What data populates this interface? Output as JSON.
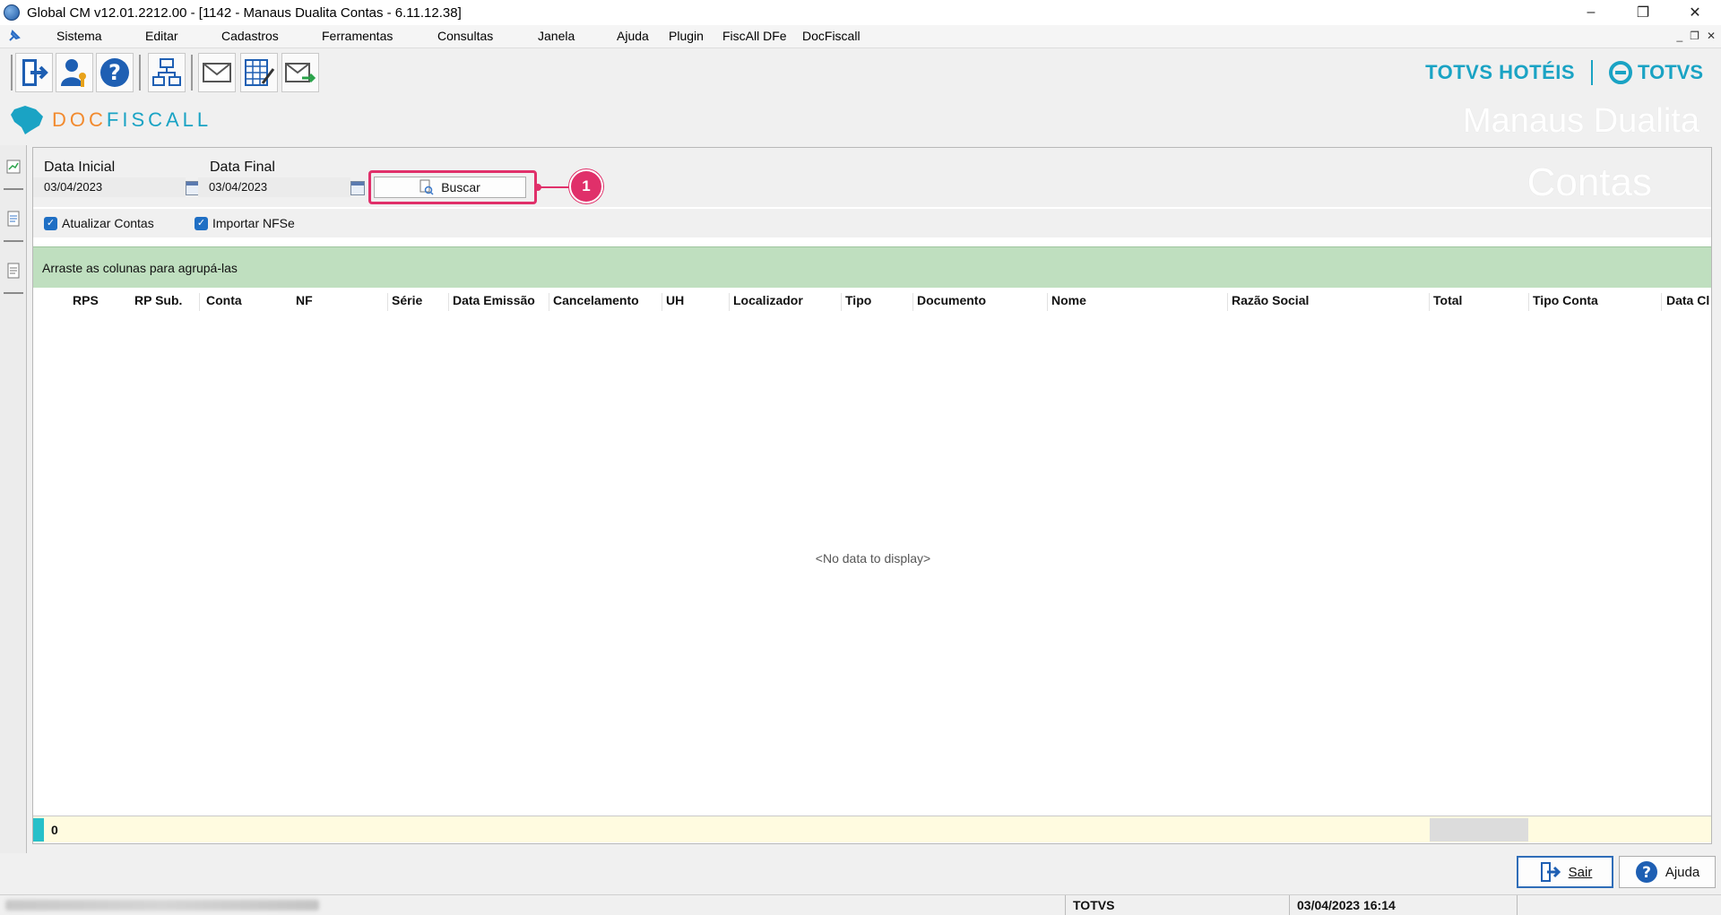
{
  "window": {
    "title": "Global CM v12.01.2212.00 - [1142 - Manaus Dualita Contas - 6.11.12.38]",
    "controls": {
      "minimize": "–",
      "restore": "❐",
      "close": "✕"
    }
  },
  "menu": {
    "items": [
      "Sistema",
      "Editar",
      "Cadastros",
      "Ferramentas",
      "Consultas",
      "Janela",
      "Ajuda",
      "Plugin",
      "FiscAll DFe",
      "DocFiscall"
    ],
    "mdi_controls": [
      "_",
      "❐",
      "✕"
    ]
  },
  "toolbar": {
    "buttons": [
      "exit-icon",
      "user-key-icon",
      "help-icon",
      "network-icon",
      "mail-icon",
      "spreadsheet-edit-icon",
      "mail-send-icon"
    ]
  },
  "brand": {
    "hoteis": "TOTVS HOTÉIS",
    "totvs": "TOTVS",
    "docfiscall_prefix": "DOC",
    "docfiscall_suffix": "FISCALL",
    "colors": {
      "accent": "#1aa3c4",
      "orange": "#f28a2e",
      "highlight": "#e0306a",
      "group_bg": "#bfdfbf"
    }
  },
  "watermark": {
    "line1": "Manaus Dualita",
    "line2": "Contas"
  },
  "filters": {
    "data_inicial_label": "Data Inicial",
    "data_inicial_value": "03/04/2023",
    "data_final_label": "Data Final",
    "data_final_value": "03/04/2023",
    "buscar_label": "Buscar",
    "callout_number": "1",
    "atualizar_contas_label": "Atualizar Contas",
    "atualizar_contas_checked": true,
    "importar_nfse_label": "Importar NFSe",
    "importar_nfse_checked": true
  },
  "grid": {
    "group_hint": "Arraste as colunas para agrupá-las",
    "columns": [
      "RPS",
      "RP Sub.",
      "Conta",
      "NF",
      "Série",
      "Data Emissão",
      "Cancelamento",
      "UH",
      "Localizador",
      "Tipo",
      "Documento",
      "Nome",
      "Razão Social",
      "Total",
      "Tipo Conta",
      "Data Cl"
    ],
    "no_data": "<No data to display>",
    "footer_count": "0"
  },
  "buttons": {
    "sair": "Sair",
    "ajuda": "Ajuda"
  },
  "status": {
    "company": "TOTVS",
    "datetime": "03/04/2023 16:14"
  }
}
